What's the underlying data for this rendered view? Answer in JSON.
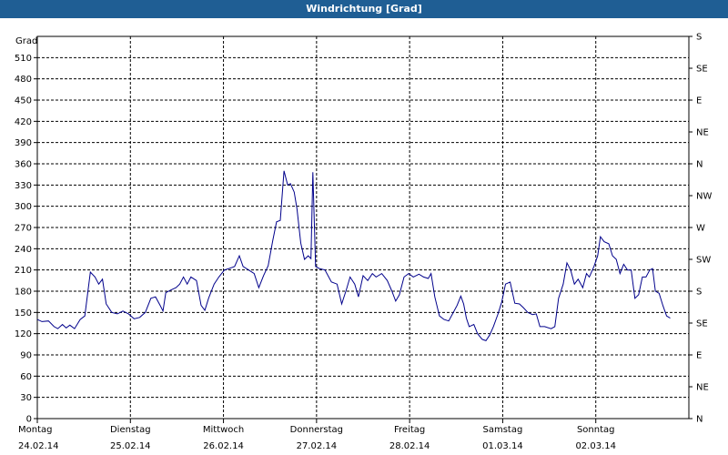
{
  "window": {
    "title": "Windrichtung [Grad]"
  },
  "chart_data": {
    "type": "line",
    "title": "Windrichtung [Grad]",
    "ylabel": "Grad",
    "ylim": [
      0,
      540
    ],
    "yticks": [
      0,
      30,
      60,
      90,
      120,
      150,
      180,
      210,
      240,
      270,
      300,
      330,
      360,
      390,
      420,
      450,
      480,
      510
    ],
    "yticks_right": [
      {
        "value": 0,
        "label": "N"
      },
      {
        "value": 45,
        "label": "NE"
      },
      {
        "value": 90,
        "label": "E"
      },
      {
        "value": 135,
        "label": "SE"
      },
      {
        "value": 180,
        "label": "S"
      },
      {
        "value": 225,
        "label": "SW"
      },
      {
        "value": 270,
        "label": "W"
      },
      {
        "value": 315,
        "label": "NW"
      },
      {
        "value": 360,
        "label": "N"
      },
      {
        "value": 405,
        "label": "NE"
      },
      {
        "value": 450,
        "label": "E"
      },
      {
        "value": 495,
        "label": "SE"
      },
      {
        "value": 540,
        "label": "S"
      }
    ],
    "xlim": [
      0,
      7
    ],
    "xticks": [
      {
        "value": 0,
        "day": "Montag",
        "date": "24.02.14"
      },
      {
        "value": 1,
        "day": "Dienstag",
        "date": "25.02.14"
      },
      {
        "value": 2,
        "day": "Mittwoch",
        "date": "26.02.14"
      },
      {
        "value": 3,
        "day": "Donnerstag",
        "date": "27.02.14"
      },
      {
        "value": 4,
        "day": "Freitag",
        "date": "28.02.14"
      },
      {
        "value": 5,
        "day": "Samstag",
        "date": "01.03.14"
      },
      {
        "value": 6,
        "day": "Sonntag",
        "date": "02.03.14"
      }
    ],
    "grid": true,
    "series_color": "#00008b",
    "series": [
      {
        "name": "",
        "points": [
          [
            0.0,
            140
          ],
          [
            0.05,
            137
          ],
          [
            0.12,
            138
          ],
          [
            0.18,
            130
          ],
          [
            0.22,
            127
          ],
          [
            0.27,
            133
          ],
          [
            0.31,
            128
          ],
          [
            0.35,
            132
          ],
          [
            0.4,
            127
          ],
          [
            0.46,
            140
          ],
          [
            0.51,
            145
          ],
          [
            0.57,
            207
          ],
          [
            0.62,
            200
          ],
          [
            0.66,
            190
          ],
          [
            0.7,
            197
          ],
          [
            0.74,
            162
          ],
          [
            0.8,
            150
          ],
          [
            0.86,
            148
          ],
          [
            0.92,
            152
          ],
          [
            0.98,
            148
          ],
          [
            1.04,
            141
          ],
          [
            1.1,
            143
          ],
          [
            1.16,
            150
          ],
          [
            1.22,
            170
          ],
          [
            1.27,
            172
          ],
          [
            1.32,
            160
          ],
          [
            1.35,
            152
          ],
          [
            1.38,
            178
          ],
          [
            1.44,
            182
          ],
          [
            1.49,
            185
          ],
          [
            1.53,
            190
          ],
          [
            1.57,
            200
          ],
          [
            1.61,
            190
          ],
          [
            1.65,
            200
          ],
          [
            1.71,
            195
          ],
          [
            1.76,
            160
          ],
          [
            1.8,
            153
          ],
          [
            1.84,
            170
          ],
          [
            1.9,
            190
          ],
          [
            1.95,
            200
          ],
          [
            2.01,
            210
          ],
          [
            2.06,
            212
          ],
          [
            2.12,
            215
          ],
          [
            2.17,
            230
          ],
          [
            2.21,
            215
          ],
          [
            2.27,
            210
          ],
          [
            2.33,
            205
          ],
          [
            2.38,
            185
          ],
          [
            2.43,
            202
          ],
          [
            2.48,
            216
          ],
          [
            2.53,
            252
          ],
          [
            2.57,
            278
          ],
          [
            2.61,
            280
          ],
          [
            2.65,
            350
          ],
          [
            2.69,
            330
          ],
          [
            2.72,
            332
          ],
          [
            2.76,
            320
          ],
          [
            2.79,
            296
          ],
          [
            2.83,
            248
          ],
          [
            2.87,
            225
          ],
          [
            2.91,
            230
          ],
          [
            2.94,
            226
          ],
          [
            2.96,
            348
          ],
          [
            2.99,
            215
          ],
          [
            3.03,
            212
          ],
          [
            3.09,
            210
          ],
          [
            3.16,
            193
          ],
          [
            3.22,
            190
          ],
          [
            3.27,
            162
          ],
          [
            3.32,
            182
          ],
          [
            3.36,
            200
          ],
          [
            3.41,
            190
          ],
          [
            3.45,
            172
          ],
          [
            3.5,
            202
          ],
          [
            3.55,
            195
          ],
          [
            3.6,
            205
          ],
          [
            3.64,
            200
          ],
          [
            3.7,
            205
          ],
          [
            3.76,
            195
          ],
          [
            3.81,
            180
          ],
          [
            3.85,
            166
          ],
          [
            3.89,
            175
          ],
          [
            3.94,
            200
          ],
          [
            3.99,
            205
          ],
          [
            4.04,
            200
          ],
          [
            4.1,
            204
          ],
          [
            4.15,
            200
          ],
          [
            4.2,
            198
          ],
          [
            4.23,
            205
          ],
          [
            4.27,
            172
          ],
          [
            4.32,
            145
          ],
          [
            4.37,
            140
          ],
          [
            4.42,
            138
          ],
          [
            4.47,
            150
          ],
          [
            4.51,
            160
          ],
          [
            4.55,
            173
          ],
          [
            4.58,
            162
          ],
          [
            4.61,
            142
          ],
          [
            4.64,
            130
          ],
          [
            4.69,
            133
          ],
          [
            4.73,
            120
          ],
          [
            4.78,
            112
          ],
          [
            4.82,
            110
          ],
          [
            4.86,
            118
          ],
          [
            4.9,
            130
          ],
          [
            4.95,
            148
          ],
          [
            4.99,
            165
          ],
          [
            5.03,
            190
          ],
          [
            5.08,
            193
          ],
          [
            5.13,
            163
          ],
          [
            5.18,
            162
          ],
          [
            5.22,
            157
          ],
          [
            5.27,
            150
          ],
          [
            5.32,
            147
          ],
          [
            5.36,
            148
          ],
          [
            5.4,
            130
          ],
          [
            5.45,
            130
          ],
          [
            5.52,
            127
          ],
          [
            5.56,
            130
          ],
          [
            5.6,
            170
          ],
          [
            5.65,
            190
          ],
          [
            5.69,
            220
          ],
          [
            5.73,
            210
          ],
          [
            5.77,
            190
          ],
          [
            5.81,
            197
          ],
          [
            5.86,
            185
          ],
          [
            5.9,
            205
          ],
          [
            5.93,
            200
          ],
          [
            5.98,
            215
          ],
          [
            6.02,
            230
          ],
          [
            6.05,
            257
          ],
          [
            6.09,
            250
          ],
          [
            6.14,
            247
          ],
          [
            6.18,
            230
          ],
          [
            6.22,
            225
          ],
          [
            6.26,
            205
          ],
          [
            6.3,
            218
          ],
          [
            6.34,
            210
          ],
          [
            6.38,
            210
          ],
          [
            6.42,
            170
          ],
          [
            6.46,
            175
          ],
          [
            6.5,
            200
          ],
          [
            6.54,
            200
          ],
          [
            6.58,
            210
          ],
          [
            6.61,
            212
          ],
          [
            6.64,
            180
          ],
          [
            6.68,
            177
          ],
          [
            6.72,
            160
          ],
          [
            6.76,
            145
          ],
          [
            6.8,
            142
          ]
        ]
      }
    ]
  }
}
